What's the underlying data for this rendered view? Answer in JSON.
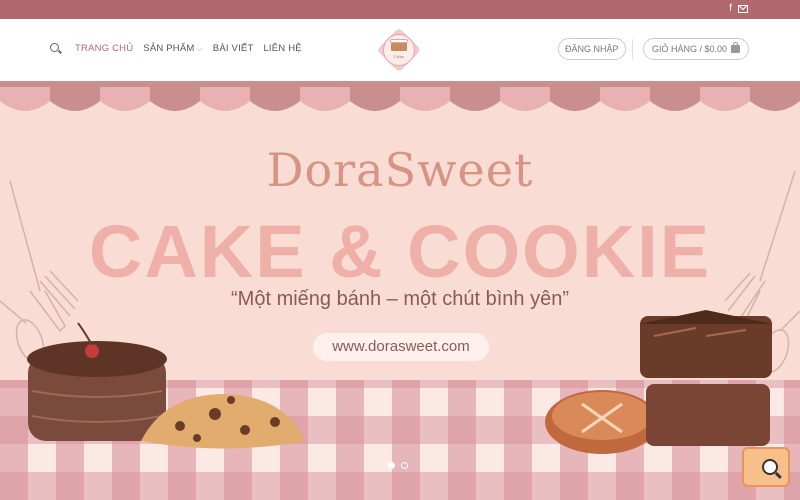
{
  "topbar": {
    "icons": [
      "facebook-icon",
      "envelope-icon"
    ],
    "facebook_glyph": "f",
    "color": "#b06a6e"
  },
  "header": {
    "nav": [
      {
        "label": "TRANG CHỦ",
        "active": true
      },
      {
        "label": "SẢN PHẨM",
        "has_dropdown": true
      },
      {
        "label": "BÀI VIẾT"
      },
      {
        "label": "LIÊN HỆ"
      }
    ],
    "logo_text": "Cake",
    "login_label": "ĐĂNG NHẬP",
    "cart_label": "GIỎ HÀNG / $0.00"
  },
  "hero": {
    "brand": "DoraSweet",
    "headline": "CAKE & COOKIE",
    "tagline": "“Một miếng bánh – một chút bình yên”",
    "url": "www.dorasweet.com",
    "slides": 2,
    "active_slide": 1,
    "bg_color": "#f9ddd4",
    "accent_color": "#eeb0a9"
  },
  "fab": {
    "icon": "search-doc-icon"
  }
}
